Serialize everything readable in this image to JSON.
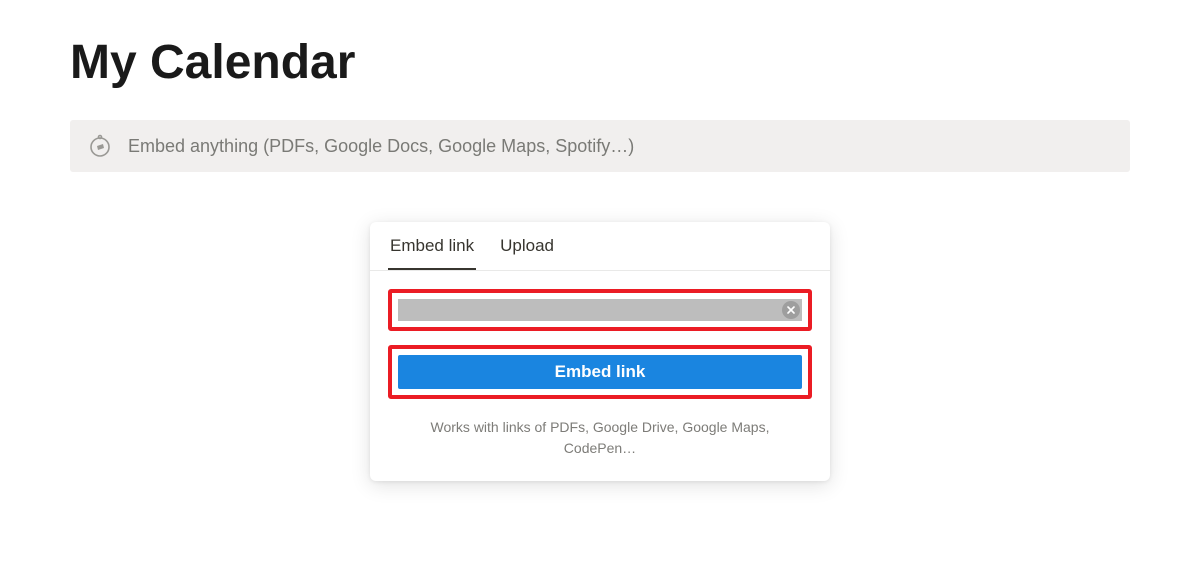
{
  "page": {
    "title": "My Calendar"
  },
  "embed_bar": {
    "placeholder_text": "Embed anything (PDFs, Google Docs, Google Maps, Spotify…)"
  },
  "popup": {
    "tabs": {
      "embed_link": "Embed link",
      "upload": "Upload"
    },
    "input": {
      "value": "",
      "placeholder": ""
    },
    "button_label": "Embed link",
    "helper_text": "Works with links of PDFs, Google Drive, Google Maps, CodePen…"
  }
}
